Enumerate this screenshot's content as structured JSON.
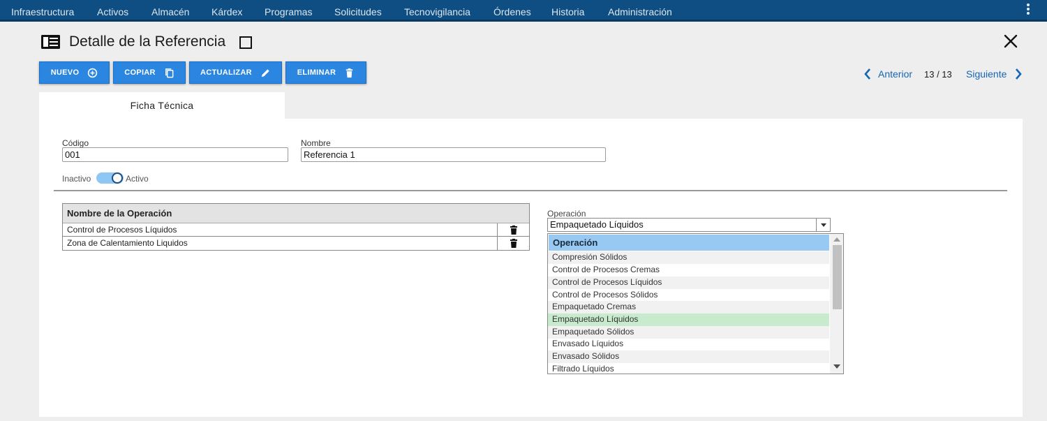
{
  "nav": {
    "items": [
      {
        "label": "Infraestructura",
        "name": "nav-item-infraestructura"
      },
      {
        "label": "Activos",
        "name": "nav-item-activos"
      },
      {
        "label": "Almacén",
        "name": "nav-item-almacen"
      },
      {
        "label": "Kárdex",
        "name": "nav-item-kardex"
      },
      {
        "label": "Programas",
        "name": "nav-item-programas"
      },
      {
        "label": "Solicitudes",
        "name": "nav-item-solicitudes"
      },
      {
        "label": "Tecnovigilancia",
        "name": "nav-item-tecnovigilancia"
      },
      {
        "label": "Órdenes",
        "name": "nav-item-ordenes"
      },
      {
        "label": "Historia",
        "name": "nav-item-historia"
      },
      {
        "label": "Administración",
        "name": "nav-item-administracion"
      }
    ],
    "menu_icon": "kebab-menu-icon",
    "bg_color": "#0e4e82"
  },
  "header": {
    "title": "Detalle de la Referencia",
    "icons": [
      "document-list-icon",
      "maximize-icon",
      "close-icon"
    ]
  },
  "toolbar": {
    "accent_color": "#2a86e0",
    "nuevo_label": "NUEVO",
    "copiar_label": "COPIAR",
    "actualizar_label": "ACTUALIZAR",
    "eliminar_label": "ELIMINAR"
  },
  "pager": {
    "prev_label": "Anterior",
    "count": "13 / 13",
    "next_label": "Siguiente"
  },
  "tabs": [
    {
      "label": "Ficha Técnica",
      "active": true
    }
  ],
  "form": {
    "codigo_label": "Código",
    "codigo_value": "001",
    "nombre_label": "Nombre",
    "nombre_value": "Referencia 1",
    "toggle_off_label": "Inactivo",
    "toggle_on_label": "Activo",
    "toggle_state": "on"
  },
  "operations_table": {
    "header": "Nombre de la Operación",
    "rows": [
      {
        "name": "Control de Procesos Líquidos"
      },
      {
        "name": "Zona de Calentamiento Liquidos"
      }
    ],
    "row_action_icon": "trash-icon"
  },
  "operation_select": {
    "label": "Operación",
    "value": "Empaquetado Líquidos",
    "dropdown_header": "Operación",
    "options": [
      "Compresión Sólidos",
      "Control de Procesos Cremas",
      "Control de Procesos Líquidos",
      "Control de Procesos Sólidos",
      "Empaquetado Cremas",
      "Empaquetado Líquidos",
      "Empaquetado Sólidos",
      "Envasado Líquidos",
      "Envasado Sólidos",
      "Filtrado Líquidos"
    ],
    "selected_index": 5,
    "selected_color": "#c8ebcd",
    "header_color": "#97c9f2"
  }
}
